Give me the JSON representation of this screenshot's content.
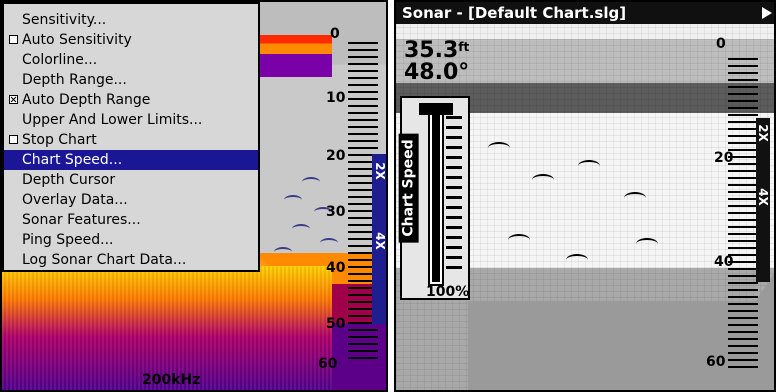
{
  "left_screen": {
    "menu": {
      "items": [
        {
          "label": "Sensitivity...",
          "checkbox": false,
          "checked": false,
          "selected": false
        },
        {
          "label": "Auto Sensitivity",
          "checkbox": true,
          "checked": false,
          "selected": false
        },
        {
          "label": "Colorline...",
          "checkbox": false,
          "checked": false,
          "selected": false
        },
        {
          "label": "Depth Range...",
          "checkbox": false,
          "checked": false,
          "selected": false
        },
        {
          "label": "Auto Depth Range",
          "checkbox": true,
          "checked": true,
          "selected": false
        },
        {
          "label": "Upper And Lower Limits...",
          "checkbox": false,
          "checked": false,
          "selected": false
        },
        {
          "label": "Stop Chart",
          "checkbox": true,
          "checked": false,
          "selected": false
        },
        {
          "label": "Chart Speed...",
          "checkbox": false,
          "checked": false,
          "selected": true
        },
        {
          "label": "Depth Cursor",
          "checkbox": false,
          "checked": false,
          "selected": false
        },
        {
          "label": "Overlay Data...",
          "checkbox": false,
          "checked": false,
          "selected": false
        },
        {
          "label": "Sonar Features...",
          "checkbox": false,
          "checked": false,
          "selected": false
        },
        {
          "label": "Ping Speed...",
          "checkbox": false,
          "checked": false,
          "selected": false
        },
        {
          "label": "Log Sonar Chart Data...",
          "checkbox": false,
          "checked": false,
          "selected": false
        }
      ]
    },
    "depth_scale": {
      "top": "0",
      "marks": [
        "10",
        "20",
        "30",
        "40",
        "50"
      ],
      "bottom": "60"
    },
    "zoom_labels": [
      "2X",
      "4X"
    ],
    "frequency": "200kHz"
  },
  "right_screen": {
    "title": "Sonar - [Default Chart.slg]",
    "readouts": {
      "depth_value": "35.3",
      "depth_unit": "ft",
      "temperature": "48.0°"
    },
    "chart_speed": {
      "label": "Chart Speed",
      "percent_text": "100%",
      "level": 1.0
    },
    "depth_scale": {
      "top": "0",
      "marks": [
        "20",
        "40"
      ],
      "bottom": "60"
    },
    "zoom_labels": [
      "2X",
      "4X"
    ]
  }
}
